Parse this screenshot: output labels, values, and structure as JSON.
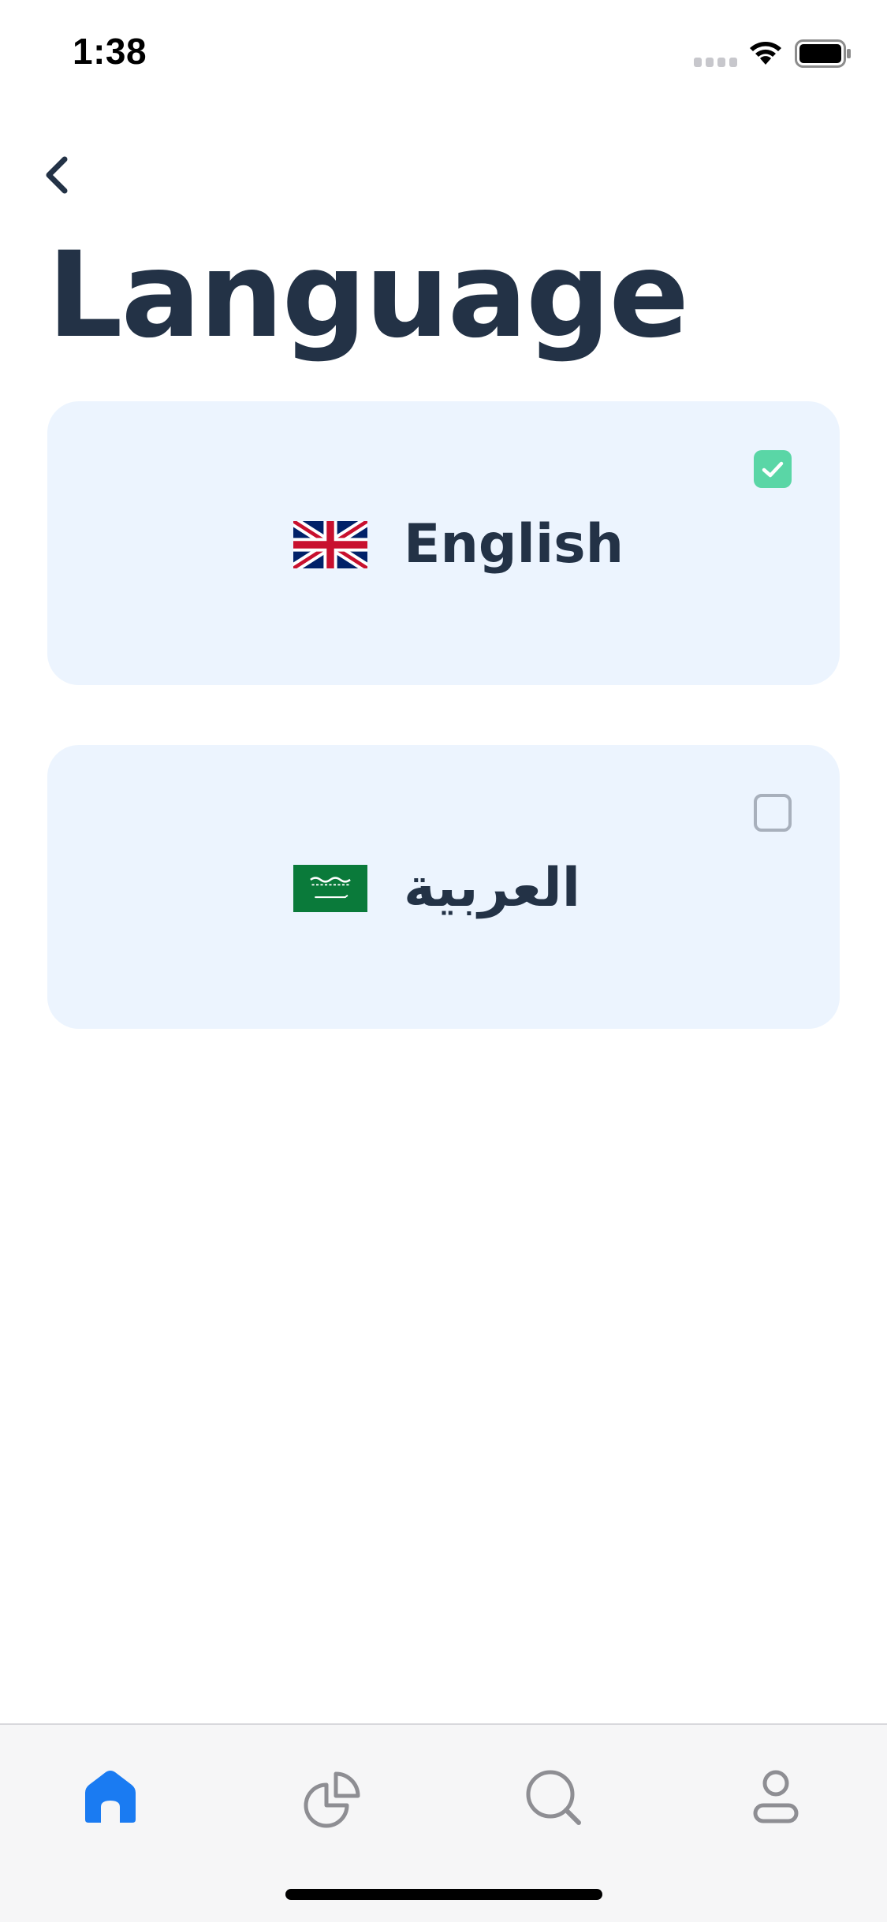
{
  "status_bar": {
    "time": "1:38"
  },
  "header": {
    "back_icon": "chevron-left-icon",
    "title": "Language"
  },
  "languages": [
    {
      "label": "English",
      "flag_icon": "uk-flag-icon",
      "selected": true
    },
    {
      "label": "العربية",
      "flag_icon": "saudi-flag-icon",
      "selected": false
    }
  ],
  "tab_bar": {
    "items": [
      {
        "icon": "home-icon",
        "active": true
      },
      {
        "icon": "pie-chart-icon",
        "active": false
      },
      {
        "icon": "search-icon",
        "active": false
      },
      {
        "icon": "profile-icon",
        "active": false
      }
    ]
  },
  "colors": {
    "title": "#233246",
    "card_background": "#ecf4fe",
    "checkbox_checked": "#5ad6a6",
    "tab_active": "#1a7bf2",
    "tab_inactive": "#8e8e93"
  }
}
